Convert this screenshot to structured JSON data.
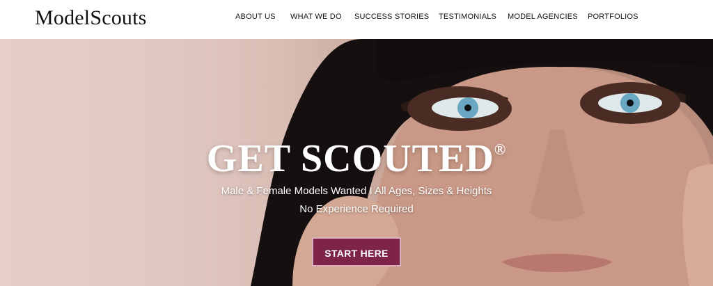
{
  "header": {
    "logo_text": "ModelScouts",
    "nav": [
      {
        "label": "ABOUT US"
      },
      {
        "label": "WHAT WE DO"
      },
      {
        "label": "SUCCESS STORIES"
      },
      {
        "label": "TESTIMONIALS"
      },
      {
        "label": "MODEL AGENCIES"
      },
      {
        "label": "PORTFOLIOS"
      }
    ]
  },
  "hero": {
    "title": "GET SCOUTED",
    "title_mark": "®",
    "subtitle_line1": "Male & Female Models Wanted I All Ages, Sizes & Heights",
    "subtitle_line2": "No Experience Required",
    "cta_label": "START HERE"
  },
  "colors": {
    "cta_bg": "#7e2448",
    "cta_border": "#d7aebd"
  }
}
